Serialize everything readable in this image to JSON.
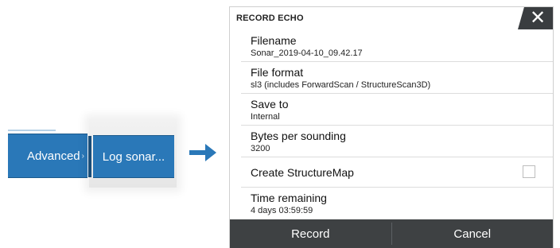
{
  "menu": {
    "advanced_label": "Advanced",
    "advanced_chevron": "›",
    "log_sonar_label": "Log sonar..."
  },
  "dialog": {
    "title": "RECORD ECHO",
    "close_icon": "✕",
    "rows": [
      {
        "label": "Filename",
        "value": "Sonar_2019-04-10_09.42.17"
      },
      {
        "label": "File format",
        "value": "sl3 (includes ForwardScan / StructureScan3D)"
      },
      {
        "label": "Save to",
        "value": "Internal"
      },
      {
        "label": "Bytes per sounding",
        "value": "3200"
      },
      {
        "label": "Create StructureMap",
        "checked": false
      },
      {
        "label": "Time remaining",
        "value": "4 days 03:59:59"
      }
    ],
    "footer": {
      "record_label": "Record",
      "cancel_label": "Cancel"
    }
  },
  "colors": {
    "menu_blue": "#2a78b8",
    "arrow_blue": "#2a78b8",
    "footer_dark": "#3e4143"
  }
}
